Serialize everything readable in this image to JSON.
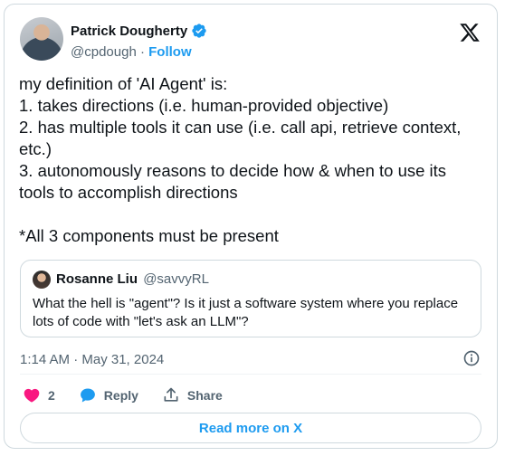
{
  "author": {
    "name": "Patrick Dougherty",
    "handle": "@cpdough",
    "separator": "·",
    "follow_label": "Follow"
  },
  "tweet": {
    "text": "my definition of 'AI Agent' is:\n1. takes directions (i.e. human-provided objective)\n2. has multiple tools it can use (i.e. call api, retrieve context, etc.)\n3. autonomously reasons to decide how & when to use its tools to accomplish directions\n\n*All 3 components must be present"
  },
  "quote": {
    "name": "Rosanne Liu",
    "handle": "@savvyRL",
    "text": "What the hell is \"agent\"? Is it just a software system where you replace lots of code with \"let's ask an LLM\"?"
  },
  "meta": {
    "timestamp": "1:14 AM · May 31, 2024"
  },
  "actions": {
    "like_count": "2",
    "reply_label": "Reply",
    "share_label": "Share"
  },
  "footer": {
    "read_more_label": "Read more on X"
  },
  "colors": {
    "accent": "#1d9bf0",
    "like": "#f91880",
    "muted": "#536471",
    "border": "#cfd9de"
  }
}
